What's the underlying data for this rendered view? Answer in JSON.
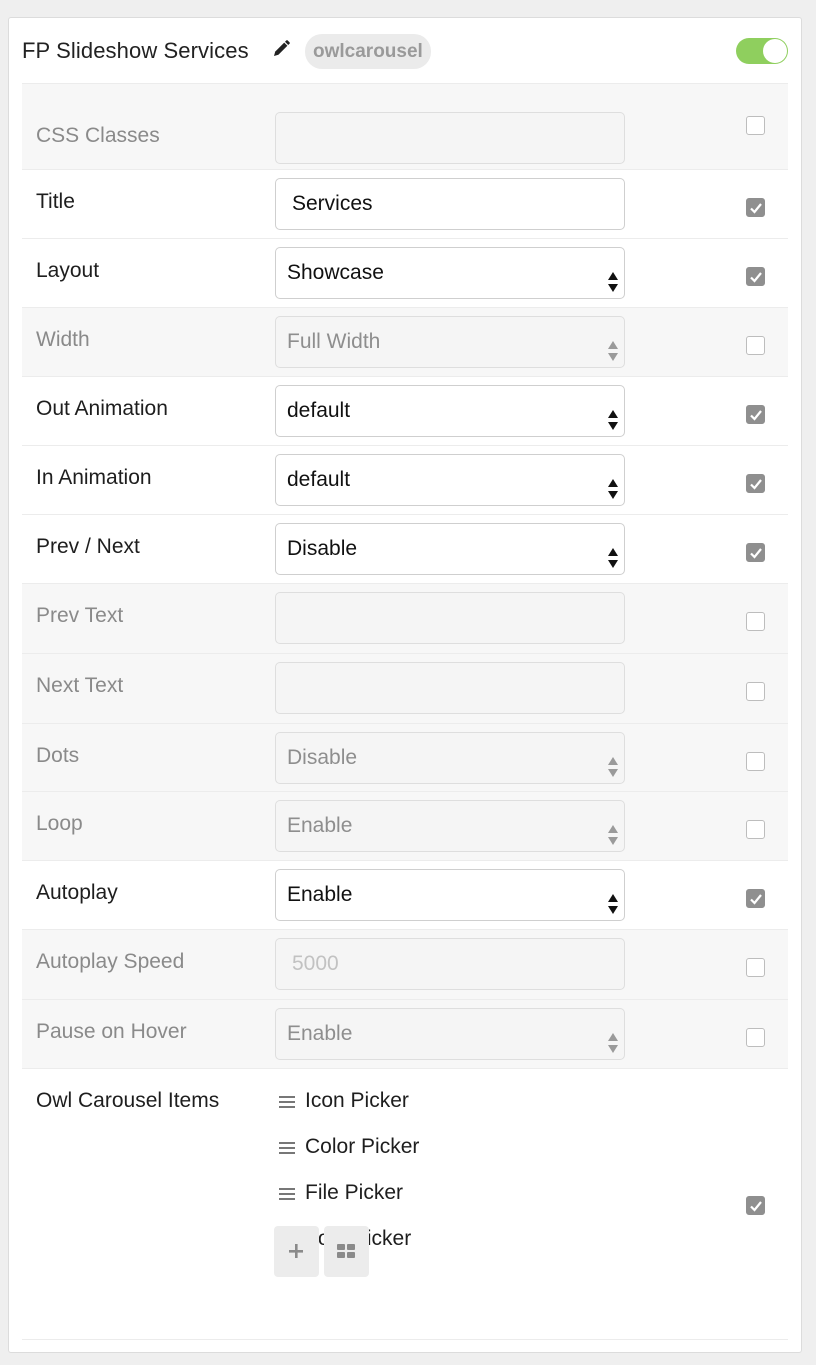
{
  "header": {
    "title": "FP Slideshow Services",
    "badge": "owlcarousel",
    "enabled": true
  },
  "rows": [
    {
      "label": "CSS Classes",
      "type": "text",
      "value": "",
      "placeholder": "",
      "checked": false
    },
    {
      "label": "Title",
      "type": "text",
      "value": "Services",
      "placeholder": "",
      "checked": true
    },
    {
      "label": "Layout",
      "type": "select",
      "value": "Showcase",
      "checked": true
    },
    {
      "label": "Width",
      "type": "select",
      "value": "Full Width",
      "checked": false
    },
    {
      "label": "Out Animation",
      "type": "select",
      "value": "default",
      "checked": true
    },
    {
      "label": "In Animation",
      "type": "select",
      "value": "default",
      "checked": true
    },
    {
      "label": "Prev / Next",
      "type": "select",
      "value": "Disable",
      "checked": true
    },
    {
      "label": "Prev Text",
      "type": "text",
      "value": "",
      "placeholder": "",
      "checked": false
    },
    {
      "label": "Next Text",
      "type": "text",
      "value": "",
      "placeholder": "",
      "checked": false
    },
    {
      "label": "Dots",
      "type": "select",
      "value": "Disable",
      "checked": false
    },
    {
      "label": "Loop",
      "type": "select",
      "value": "Enable",
      "checked": false
    },
    {
      "label": "Autoplay",
      "type": "select",
      "value": "Enable",
      "checked": true
    },
    {
      "label": "Autoplay Speed",
      "type": "text",
      "value": "",
      "placeholder": "5000",
      "checked": false
    },
    {
      "label": "Pause on Hover",
      "type": "select",
      "value": "Enable",
      "checked": false
    }
  ],
  "carousel": {
    "label": "Owl Carousel Items",
    "items": [
      "Icon Picker",
      "Color Picker",
      "File Picker",
      "Font Picker"
    ],
    "checked": true
  },
  "colors": {
    "toggle_on": "#8fcf5e",
    "checkbox_on": "#8f8f8f",
    "disabled_row": "#f7f7f7"
  }
}
